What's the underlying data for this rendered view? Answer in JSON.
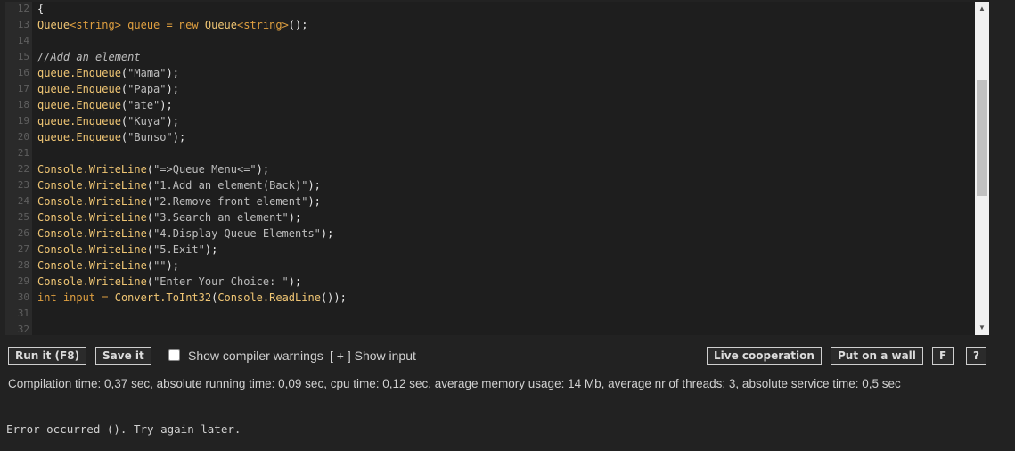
{
  "editor": {
    "lines": [
      {
        "num": "12",
        "tokens": [
          {
            "t": "{",
            "c": "t-punc"
          }
        ]
      },
      {
        "num": "13",
        "tokens": [
          {
            "t": "Queue",
            "c": "t-type"
          },
          {
            "t": "<string>",
            "c": "t-plain"
          },
          {
            "t": " queue = ",
            "c": "t-plain"
          },
          {
            "t": "new",
            "c": "t-kw"
          },
          {
            "t": " Queue",
            "c": "t-type"
          },
          {
            "t": "<string>",
            "c": "t-plain"
          },
          {
            "t": "();",
            "c": "t-punc"
          }
        ]
      },
      {
        "num": "14",
        "tokens": []
      },
      {
        "num": "15",
        "tokens": [
          {
            "t": "//Add an element",
            "c": "t-comment"
          }
        ]
      },
      {
        "num": "16",
        "tokens": [
          {
            "t": "queue.Enqueue",
            "c": "t-type"
          },
          {
            "t": "(",
            "c": "t-punc"
          },
          {
            "t": "\"Mama\"",
            "c": "t-str"
          },
          {
            "t": ");",
            "c": "t-punc"
          }
        ]
      },
      {
        "num": "17",
        "tokens": [
          {
            "t": "queue.Enqueue",
            "c": "t-type"
          },
          {
            "t": "(",
            "c": "t-punc"
          },
          {
            "t": "\"Papa\"",
            "c": "t-str"
          },
          {
            "t": ");",
            "c": "t-punc"
          }
        ]
      },
      {
        "num": "18",
        "tokens": [
          {
            "t": "queue.Enqueue",
            "c": "t-type"
          },
          {
            "t": "(",
            "c": "t-punc"
          },
          {
            "t": "\"ate\"",
            "c": "t-str"
          },
          {
            "t": ");",
            "c": "t-punc"
          }
        ]
      },
      {
        "num": "19",
        "tokens": [
          {
            "t": "queue.Enqueue",
            "c": "t-type"
          },
          {
            "t": "(",
            "c": "t-punc"
          },
          {
            "t": "\"Kuya\"",
            "c": "t-str"
          },
          {
            "t": ");",
            "c": "t-punc"
          }
        ]
      },
      {
        "num": "20",
        "tokens": [
          {
            "t": "queue.Enqueue",
            "c": "t-type"
          },
          {
            "t": "(",
            "c": "t-punc"
          },
          {
            "t": "\"Bunso\"",
            "c": "t-str"
          },
          {
            "t": ");",
            "c": "t-punc"
          }
        ]
      },
      {
        "num": "21",
        "tokens": []
      },
      {
        "num": "22",
        "tokens": [
          {
            "t": "Console.WriteLine",
            "c": "t-type"
          },
          {
            "t": "(",
            "c": "t-punc"
          },
          {
            "t": "\"=>Queue Menu<=\"",
            "c": "t-str"
          },
          {
            "t": ");",
            "c": "t-punc"
          }
        ]
      },
      {
        "num": "23",
        "tokens": [
          {
            "t": "Console.WriteLine",
            "c": "t-type"
          },
          {
            "t": "(",
            "c": "t-punc"
          },
          {
            "t": "\"1.Add an element(Back)\"",
            "c": "t-str"
          },
          {
            "t": ");",
            "c": "t-punc"
          }
        ]
      },
      {
        "num": "24",
        "tokens": [
          {
            "t": "Console.WriteLine",
            "c": "t-type"
          },
          {
            "t": "(",
            "c": "t-punc"
          },
          {
            "t": "\"2.Remove front element\"",
            "c": "t-str"
          },
          {
            "t": ");",
            "c": "t-punc"
          }
        ]
      },
      {
        "num": "25",
        "tokens": [
          {
            "t": "Console.WriteLine",
            "c": "t-type"
          },
          {
            "t": "(",
            "c": "t-punc"
          },
          {
            "t": "\"3.Search an element\"",
            "c": "t-str"
          },
          {
            "t": ");",
            "c": "t-punc"
          }
        ]
      },
      {
        "num": "26",
        "tokens": [
          {
            "t": "Console.WriteLine",
            "c": "t-type"
          },
          {
            "t": "(",
            "c": "t-punc"
          },
          {
            "t": "\"4.Display Queue Elements\"",
            "c": "t-str"
          },
          {
            "t": ");",
            "c": "t-punc"
          }
        ]
      },
      {
        "num": "27",
        "tokens": [
          {
            "t": "Console.WriteLine",
            "c": "t-type"
          },
          {
            "t": "(",
            "c": "t-punc"
          },
          {
            "t": "\"5.Exit\"",
            "c": "t-str"
          },
          {
            "t": ");",
            "c": "t-punc"
          }
        ]
      },
      {
        "num": "28",
        "tokens": [
          {
            "t": "Console.WriteLine",
            "c": "t-type"
          },
          {
            "t": "(",
            "c": "t-punc"
          },
          {
            "t": "\"\"",
            "c": "t-str"
          },
          {
            "t": ");",
            "c": "t-punc"
          }
        ]
      },
      {
        "num": "29",
        "tokens": [
          {
            "t": "Console.WriteLine",
            "c": "t-type"
          },
          {
            "t": "(",
            "c": "t-punc"
          },
          {
            "t": "\"Enter Your Choice: \"",
            "c": "t-str"
          },
          {
            "t": ");",
            "c": "t-punc"
          }
        ]
      },
      {
        "num": "30",
        "tokens": [
          {
            "t": "int",
            "c": "t-kw"
          },
          {
            "t": " input = ",
            "c": "t-plain"
          },
          {
            "t": "Convert.ToInt32",
            "c": "t-type"
          },
          {
            "t": "(",
            "c": "t-punc"
          },
          {
            "t": "Console.ReadLine",
            "c": "t-type"
          },
          {
            "t": "());",
            "c": "t-punc"
          }
        ]
      },
      {
        "num": "31",
        "tokens": []
      },
      {
        "num": "32",
        "tokens": []
      }
    ]
  },
  "scrollbar": {
    "up_icon": "▲",
    "down_icon": "▼"
  },
  "toolbar": {
    "run_label": "Run it (F8)",
    "save_label": "Save it",
    "warnings_label": "Show compiler warnings",
    "warnings_checked": false,
    "show_input_label": "[ + ] Show input",
    "live_coop_label": "Live cooperation",
    "wall_label": "Put on a wall",
    "f_label": "F",
    "help_label": "?"
  },
  "stats": "Compilation time: 0,37 sec, absolute running time: 0,09 sec, cpu time: 0,12 sec, average memory usage: 14 Mb, average nr of threads: 3, absolute service time: 0,5 sec",
  "output": "Error occurred (). Try again later."
}
